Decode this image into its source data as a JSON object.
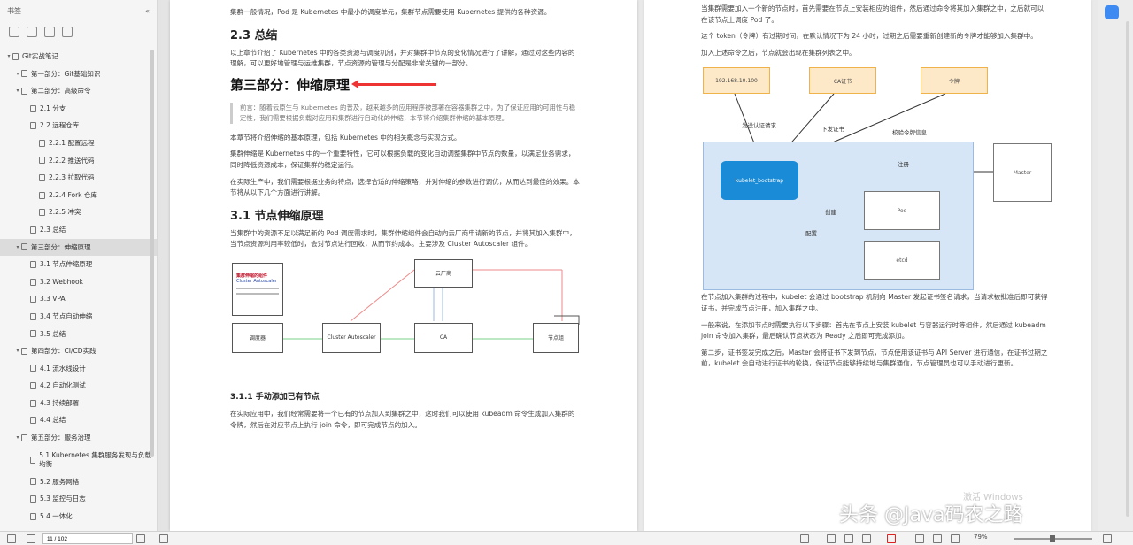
{
  "sidebar": {
    "title": "书签",
    "toc": [
      {
        "label": "Git实战笔记",
        "level": 0
      },
      {
        "label": "第一部分：Git基础知识",
        "level": 1
      },
      {
        "label": "第二部分：高级命令",
        "level": 1
      },
      {
        "label": "2.1 分支",
        "level": 2
      },
      {
        "label": "2.2 远程仓库",
        "level": 2
      },
      {
        "label": "2.2.1 配置远程",
        "level": 3
      },
      {
        "label": "2.2.2 推送代码",
        "level": 3
      },
      {
        "label": "2.2.3 拉取代码",
        "level": 3
      },
      {
        "label": "2.2.4 Fork 仓库",
        "level": 3
      },
      {
        "label": "2.2.5 冲突",
        "level": 3
      },
      {
        "label": "2.3 总结",
        "level": 2
      },
      {
        "label": "第三部分：伸缩原理",
        "level": 1,
        "active": true
      },
      {
        "label": "3.1 节点伸缩原理",
        "level": 2
      },
      {
        "label": "3.2 Webhook",
        "level": 2
      },
      {
        "label": "3.3 VPA",
        "level": 2
      },
      {
        "label": "3.4 节点自动伸缩",
        "level": 2
      },
      {
        "label": "3.5 总结",
        "level": 2
      },
      {
        "label": "第四部分：CI/CD实践",
        "level": 1
      },
      {
        "label": "4.1 流水线设计",
        "level": 2
      },
      {
        "label": "4.2 自动化测试",
        "level": 2
      },
      {
        "label": "4.3 持续部署",
        "level": 2
      },
      {
        "label": "4.4 总结",
        "level": 2
      },
      {
        "label": "第五部分：服务治理",
        "level": 1
      },
      {
        "label": "5.1 Kubernetes 集群服务发现与负载均衡",
        "level": 2,
        "tall": true
      },
      {
        "label": "5.2 服务网格",
        "level": 2
      },
      {
        "label": "5.3 监控与日志",
        "level": 2
      },
      {
        "label": "5.4 一体化",
        "level": 2
      }
    ]
  },
  "left_page": {
    "para0": "集群一般情况，Pod 是 Kubernetes 中最小的调度单元，集群节点需要使用 Kubernetes 提供的各种资源。",
    "h_23": "2.3 总结",
    "para1": "以上章节介绍了 Kubernetes 中的各类资源与调度机制，并对集群中节点的变化情况进行了讲解，通过对这些内容的理解，可以更好地管理与运维集群，节点资源的管理与分配是非常关键的一部分。",
    "h_part3": "第三部分：伸缩原理",
    "quote": "前言：随着云原生与 Kubernetes 的普及，越来越多的应用程序被部署在容器集群之中，为了保证应用的可用性与稳定性，我们需要根据负载对应用和集群进行自动化的伸缩，本节将介绍集群伸缩的基本原理。",
    "para2": "本章节将介绍伸缩的基本原理，包括 Kubernetes 中的相关概念与实现方式。",
    "para3": "集群伸缩是 Kubernetes 中的一个重要特性，它可以根据负载的变化自动调整集群中节点的数量，以满足业务需求，同时降低资源成本，保证集群的稳定运行。",
    "para4": "在实际生产中，我们需要根据业务的特点，选择合适的伸缩策略，并对伸缩的参数进行调优，从而达到最佳的效果。本节将从以下几个方面进行讲解。",
    "h_31": "3.1 节点伸缩原理",
    "para5": "当集群中的资源不足以满足新的 Pod 调度需求时，集群伸缩组件会自动向云厂商申请新的节点，并将其加入集群中，当节点资源利用率较低时，会对节点进行回收，从而节约成本。主要涉及 Cluster Autoscaler 组件。",
    "diag_doc_t1": "集群伸缩的组件",
    "diag_doc_t2": "Cluster Autoscaler",
    "diag_box_a": "调度器",
    "diag_box_b": "云厂商",
    "diag_box_c": "Cluster Autoscaler",
    "diag_box_d": "CA",
    "diag_box_e": "节点组",
    "h_311": "3.1.1 手动添加已有节点",
    "para6": "在实际应用中，我们经常需要将一个已有的节点加入到集群之中，这时我们可以使用 kubeadm 命令生成加入集群的令牌，然后在对应节点上执行 join 命令，即可完成节点的加入。"
  },
  "right_page": {
    "para0": "当集群需要加入一个新的节点时，首先需要在节点上安装相应的组件，然后通过命令将其加入集群之中，之后就可以在该节点上调度 Pod 了。",
    "para1": "这个 token（令牌）有过期时间，在默认情况下为 24 小时，过期之后需要重新创建新的令牌才能够加入集群中。",
    "para2": "加入上述命令之后，节点就会出现在集群列表之中。",
    "d_box1": "192.168.10.100",
    "d_box2": "CA证书",
    "d_box3": "令牌",
    "d_lbl1": "发送认证请求",
    "d_lbl2": "下发证书",
    "d_lbl3": "校验令牌信息",
    "d_node": "kubelet_bootstrap",
    "d_lbl4": "注册",
    "d_master": "Master",
    "d_lbl5": "创建",
    "d_w1": "Pod",
    "d_lbl6": "配置",
    "d_w2": "etcd",
    "para3": "在节点加入集群的过程中，kubelet 会通过 bootstrap 机制向 Master 发起证书签名请求，当请求被批准后即可获得证书，并完成节点注册，加入集群之中。",
    "para4": "一般来说，在添加节点时需要执行以下步骤：首先在节点上安装 kubelet 与容器运行时等组件，然后通过 kubeadm join 命令加入集群，最后确认节点状态为 Ready 之后即可完成添加。",
    "para5": "第二步，证书签发完成之后，Master 会将证书下发到节点，节点使用该证书与 API Server 进行通信，在证书过期之前，kubelet 会自动进行证书的轮换，保证节点能够持续地与集群通信，节点管理员也可以手动进行更新。"
  },
  "watermarks": {
    "windows": "激活 Windows",
    "handle": "头条 @Java码农之路"
  },
  "status": {
    "page_input": "11 / 102",
    "zoom": "79%"
  }
}
